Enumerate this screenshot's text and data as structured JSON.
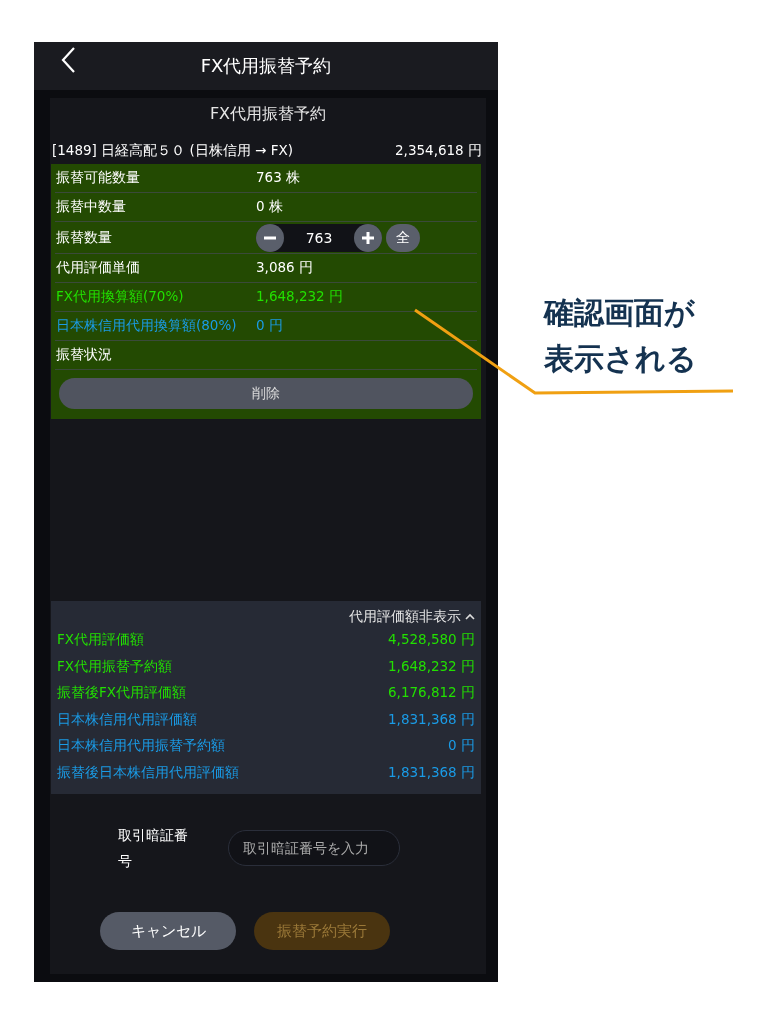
{
  "header": {
    "title": "FX代用振替予約"
  },
  "panel_title": "FX代用振替予約",
  "stock": {
    "name": "[1489] 日経高配５０ (日株信用 → FX)",
    "amount": "2,354,618 円"
  },
  "details": [
    {
      "kind": "text",
      "label": "振替可能数量",
      "value": "763 株",
      "color": "#ffffff"
    },
    {
      "kind": "text",
      "label": "振替中数量",
      "value": "0 株",
      "color": "#ffffff"
    },
    {
      "kind": "stepper",
      "label": "振替数量",
      "value": "763",
      "all_label": "全",
      "color": "#ffffff"
    },
    {
      "kind": "text",
      "label": "代用評価単価",
      "value": "3,086 円",
      "color": "#ffffff"
    },
    {
      "kind": "text",
      "label": "FX代用換算額(70%)",
      "value": "1,648,232 円",
      "color": "#22e000"
    },
    {
      "kind": "text",
      "label": "日本株信用代用換算額(80%)",
      "value": "0 円",
      "color": "#1a9be6"
    },
    {
      "kind": "text",
      "label": "振替状況",
      "color": "#ffffff"
    }
  ],
  "delete_button": "削除",
  "summary": {
    "toggle": "代用評価額非表示",
    "expanded": true,
    "rows": [
      {
        "label": "FX代用評価額",
        "value": "4,528,580 円",
        "color": "#22e000"
      },
      {
        "label": "FX代用振替予約額",
        "value": "1,648,232 円",
        "color": "#22e000"
      },
      {
        "label": "振替後FX代用評価額",
        "value": "6,176,812 円",
        "color": "#22e000"
      },
      {
        "label": "日本株信用代用評価額",
        "value": "1,831,368 円",
        "color": "#1a9be6"
      },
      {
        "label": "日本株信用代用振替予約額",
        "value": "0 円",
        "color": "#1a9be6"
      },
      {
        "label": "振替後日本株信用代用評価額",
        "value": "1,831,368 円",
        "color": "#1a9be6"
      }
    ]
  },
  "password": {
    "label": "取引暗証番号",
    "placeholder": "取引暗証番号を入力"
  },
  "buttons": [
    {
      "label": "キャンセル",
      "kind": "cancel",
      "disabled": false
    },
    {
      "label": "振替予約実行",
      "kind": "execute",
      "disabled": true
    }
  ],
  "annotation": {
    "text": "確認画面が表示される"
  }
}
